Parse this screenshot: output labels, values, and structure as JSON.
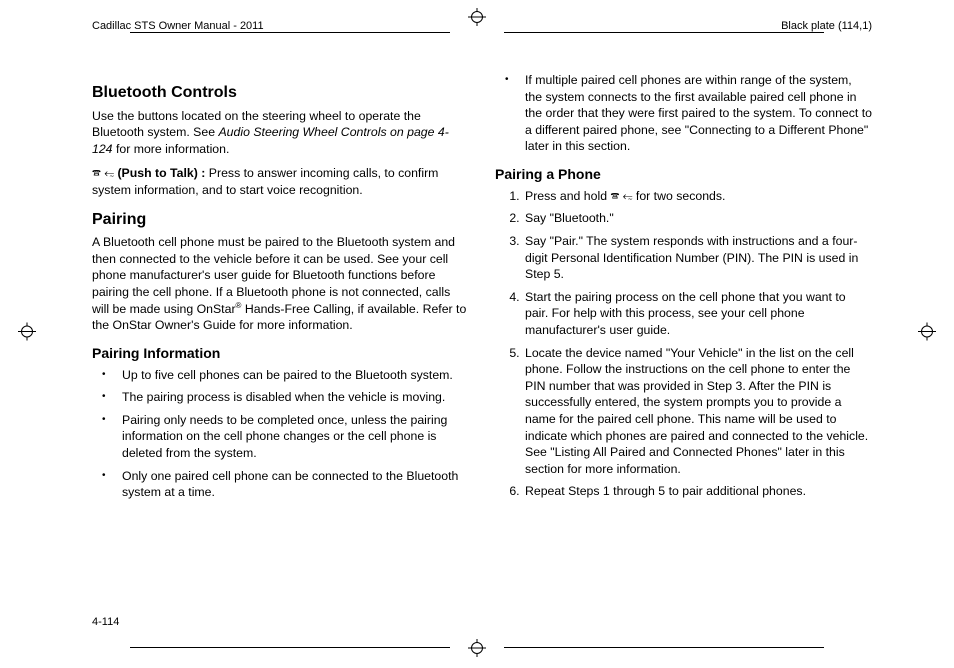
{
  "header": {
    "manual_title": "Cadillac STS Owner Manual - 2011",
    "plate_label": "Black plate (114,1)"
  },
  "page_number": "4-114",
  "glyphs": {
    "push_to_talk": "🕿 ⥳"
  },
  "left_col": {
    "sec1_title": "Bluetooth Controls",
    "sec1_p1_a": "Use the buttons located on the steering wheel to operate the Bluetooth system. See ",
    "sec1_p1_ref": "Audio Steering Wheel Controls on page 4-124",
    "sec1_p1_b": " for more information.",
    "sec1_p2_label": " (Push to Talk) : ",
    "sec1_p2_rest": "Press to answer incoming calls, to confirm system information, and to start voice recognition.",
    "sec2_title": "Pairing",
    "sec2_p1_a": "A Bluetooth cell phone must be paired to the Bluetooth system and then connected to the vehicle before it can be used. See your cell phone manufacturer's user guide for Bluetooth functions before pairing the cell phone. If a Bluetooth phone is not connected, calls will be made using OnStar",
    "sec2_p1_sup": "®",
    "sec2_p1_b": " Hands-Free Calling, if available. Refer to the OnStar Owner's Guide for more information.",
    "sec2_sub": "Pairing Information",
    "sec2_bullets": [
      "Up to five cell phones can be paired to the Bluetooth system.",
      "The pairing process is disabled when the vehicle is moving.",
      "Pairing only needs to be completed once, unless the pairing information on the cell phone changes or the cell phone is deleted from the system.",
      "Only one paired cell phone can be connected to the Bluetooth system at a time."
    ]
  },
  "right_col": {
    "top_bullet": "If multiple paired cell phones are within range of the system, the system connects to the first available paired cell phone in the order that they were first paired to the system. To connect to a different paired phone, see \"Connecting to a Different Phone\" later in this section.",
    "sub_title": "Pairing a Phone",
    "steps": [
      {
        "pre": "Press and hold ",
        "glyph": true,
        "post": " for two seconds."
      },
      {
        "pre": "Say \"Bluetooth.\""
      },
      {
        "pre": "Say \"Pair.\" The system responds with instructions and a four-digit Personal Identification Number (PIN). The PIN is used in Step 5."
      },
      {
        "pre": "Start the pairing process on the cell phone that you want to pair. For help with this process, see your cell phone manufacturer's user guide."
      },
      {
        "pre": "Locate the device named \"Your Vehicle\" in the list on the cell phone. Follow the instructions on the cell phone to enter the PIN number that was provided in Step 3. After the PIN is successfully entered, the system prompts you to provide a name for the paired cell phone. This name will be used to indicate which phones are paired and connected to the vehicle. See \"Listing All Paired and Connected Phones\" later in this section for more information."
      },
      {
        "pre": "Repeat Steps 1 through 5 to pair additional phones."
      }
    ]
  }
}
